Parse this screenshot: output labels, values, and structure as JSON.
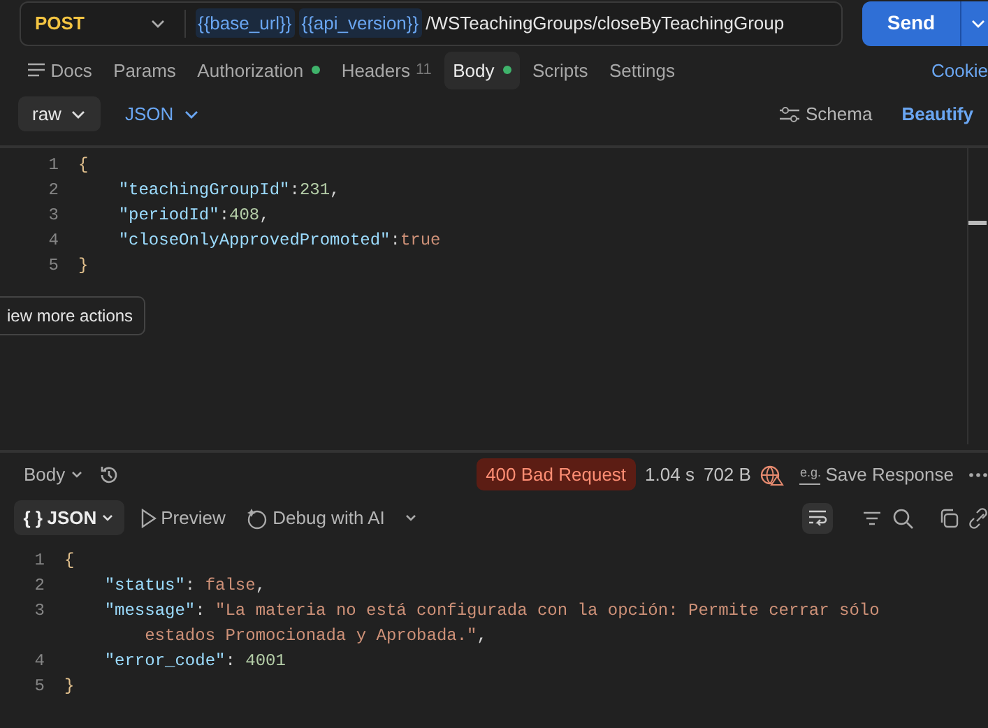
{
  "request": {
    "method": "POST",
    "url_parts": [
      {
        "kind": "variable",
        "text": "{{base_url}}"
      },
      {
        "kind": "variable",
        "text": "{{api_version}}"
      },
      {
        "kind": "path",
        "text": "/WSTeachingGroups/closeByTeachingGroup"
      }
    ],
    "send": "Send"
  },
  "tabs": [
    {
      "label": "Docs",
      "selected": false,
      "indicator": false
    },
    {
      "label": "Params",
      "selected": false,
      "indicator": false
    },
    {
      "label": "Authorization",
      "selected": false,
      "indicator": true
    },
    {
      "label": "Headers",
      "count": "11",
      "selected": false,
      "indicator": false
    },
    {
      "label": "Body",
      "selected": true,
      "indicator": true
    },
    {
      "label": "Scripts",
      "selected": false,
      "indicator": false
    },
    {
      "label": "Settings",
      "selected": false,
      "indicator": false
    }
  ],
  "cookies_link": "Cookie",
  "body_toolbar": {
    "mode": "raw",
    "language": "JSON",
    "schema": "Schema",
    "beautify": "Beautify"
  },
  "request_body": [
    {
      "number": "1",
      "tokens": [
        {
          "kind": "brace",
          "text": "{"
        }
      ]
    },
    {
      "number": "2",
      "tokens": [
        {
          "kind": "key",
          "text": "    \"teachingGroupId\""
        },
        {
          "kind": "punct",
          "text": ":"
        },
        {
          "kind": "number",
          "text": "231"
        },
        {
          "kind": "punct",
          "text": ","
        }
      ]
    },
    {
      "number": "3",
      "tokens": [
        {
          "kind": "key",
          "text": "    \"periodId\""
        },
        {
          "kind": "punct",
          "text": ":"
        },
        {
          "kind": "number",
          "text": "408"
        },
        {
          "kind": "punct",
          "text": ","
        }
      ]
    },
    {
      "number": "4",
      "tokens": [
        {
          "kind": "key",
          "text": "    \"closeOnlyApprovedPromoted\""
        },
        {
          "kind": "punct",
          "text": ":"
        },
        {
          "kind": "literal",
          "text": "true"
        }
      ]
    },
    {
      "number": "5",
      "tokens": [
        {
          "kind": "brace",
          "text": "}"
        }
      ]
    }
  ],
  "tooltip": "iew more actions",
  "response": {
    "view": "Body",
    "status": "400 Bad Request",
    "time": "1.04 s",
    "size": "702 B",
    "save_icon_text": "e.g.",
    "save": "Save Response",
    "format_braces": "{ }",
    "format": "JSON",
    "preview": "Preview",
    "debug": "Debug with AI",
    "lines": [
      {
        "number": "1",
        "tokens": [
          {
            "kind": "brace",
            "text": "{"
          }
        ]
      },
      {
        "number": "2",
        "tokens": [
          {
            "kind": "key",
            "text": "    \"status\""
          },
          {
            "kind": "punct",
            "text": ": "
          },
          {
            "kind": "literal",
            "text": "false"
          },
          {
            "kind": "punct",
            "text": ","
          }
        ]
      },
      {
        "number": "3",
        "tokens": [
          {
            "kind": "key",
            "text": "    \"message\""
          },
          {
            "kind": "punct",
            "text": ": "
          },
          {
            "kind": "literal",
            "text": "\"La materia no está configurada con la opción: Permite cerrar sólo estados Promocionada y Aprobada.\""
          },
          {
            "kind": "punct",
            "text": ","
          }
        ]
      },
      {
        "number": "4",
        "tokens": [
          {
            "kind": "key",
            "text": "    \"error_code\""
          },
          {
            "kind": "punct",
            "text": ": "
          },
          {
            "kind": "number",
            "text": "4001"
          }
        ]
      },
      {
        "number": "5",
        "tokens": [
          {
            "kind": "brace",
            "text": "}"
          }
        ]
      }
    ]
  }
}
